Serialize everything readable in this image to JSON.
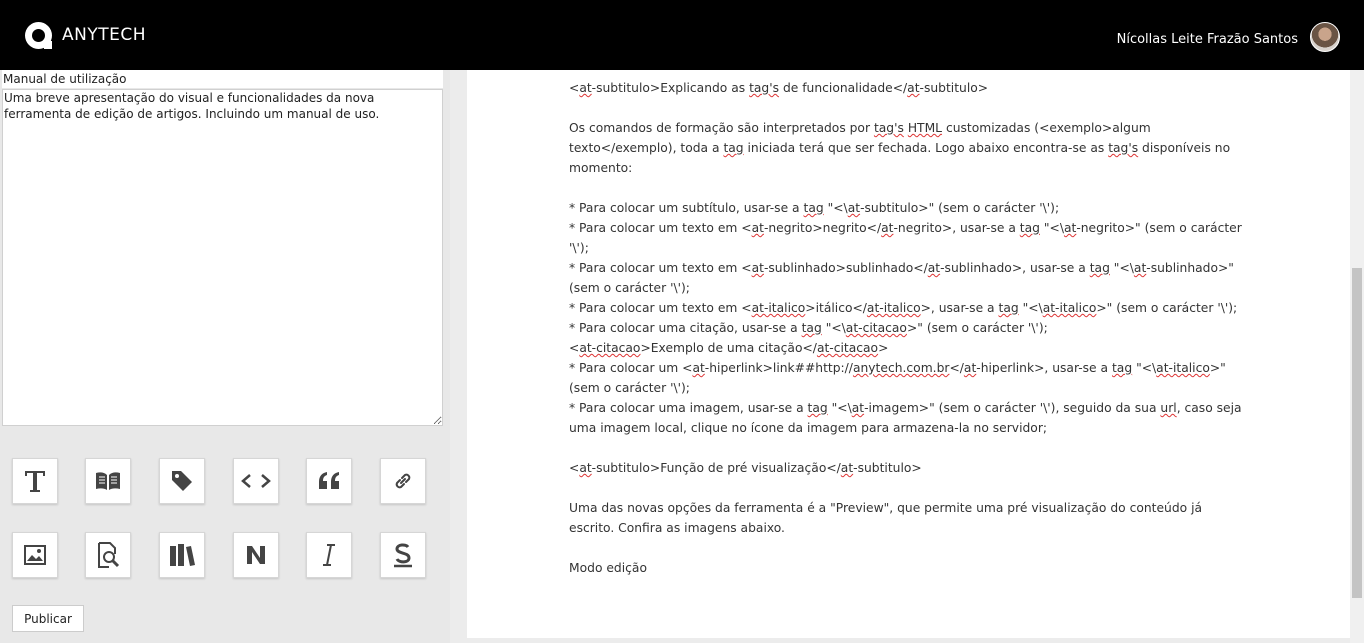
{
  "header": {
    "brand": "ANYTECH",
    "user_name": "Nícollas Leite Frazão Santos"
  },
  "editor": {
    "title_value": "Manual de utilização",
    "description_value": "Uma breve apresentação do visual e funcionalidades da nova ferramenta de edição de artigos. Incluindo um manual de uso.",
    "publish_label": "Publicar"
  },
  "toolbar": {
    "row1": [
      "subtitle",
      "reading",
      "tag",
      "code",
      "quote",
      "link"
    ],
    "row2": [
      "image",
      "preview",
      "library",
      "bold",
      "italic",
      "underline"
    ]
  },
  "article": {
    "l1": [
      "<",
      "at",
      "-subtitulo>Explicando as ",
      "tag's",
      " de funcionalidade</",
      "at",
      "-subtitulo>"
    ],
    "l2": [
      "Os comandos de formação são interpretados por ",
      "tag's",
      " ",
      "HTML",
      " customizadas (<exemplo>algum texto</exemplo), toda a ",
      "tag",
      " iniciada terá que ser fechada. Logo abaixo encontra-se as ",
      "tag's",
      " disponíveis no momento:"
    ],
    "l3": [
      "* Para colocar um subtítulo, usar-se a ",
      "tag",
      " \"<\\",
      "at",
      "-subtitulo>\" (sem o carácter '\\');"
    ],
    "l4": [
      "* Para colocar um texto em <",
      "at",
      "-negrito>negrito</",
      "at",
      "-negrito>, usar-se a ",
      "tag",
      " \"<\\",
      "at",
      "-negrito>\" (sem o carácter '\\');"
    ],
    "l5": [
      "* Para colocar um texto em <",
      "at",
      "-sublinhado>sublinhado</",
      "at",
      "-sublinhado>, usar-se a ",
      "tag",
      " \"<\\",
      "at",
      "-sublinhado>\" (sem o carácter '\\');"
    ],
    "l6": [
      "* Para colocar um texto em <",
      "at-italico",
      ">itálico</",
      "at-italico",
      ">, usar-se a ",
      "tag",
      " \"<\\",
      "at-italico",
      ">\" (sem o carácter '\\');"
    ],
    "l7": [
      "* Para colocar uma citação, usar-se a ",
      "tag",
      " \"<\\",
      "at-citacao",
      ">\" (sem o carácter '\\');"
    ],
    "l8": [
      "<",
      "at-citacao",
      ">Exemplo de uma citação</",
      "at-citacao",
      ">"
    ],
    "l9": [
      "* Para colocar um <",
      "at",
      "-hiperlink>link##http://",
      "anytech.com.br",
      "</",
      "at",
      "-hiperlink>, usar-se a ",
      "tag",
      " \"<\\",
      "at-italico",
      ">\" (sem o carácter '\\');"
    ],
    "l10": [
      "* Para colocar uma imagem, usar-se a ",
      "tag",
      " \"<\\",
      "at",
      "-imagem>\" (sem o carácter '\\'), seguido da sua ",
      "url",
      ", caso seja uma imagem local, clique no ícone da imagem para armazena-la no servidor;"
    ],
    "l11": [
      "<",
      "at",
      "-subtitulo>Função de pré visualização</",
      "at",
      "-subtitulo>"
    ],
    "l12": [
      "Uma das novas opções da ferramenta é a \"Preview\", que permite uma pré visualização do conteúdo já escrito. Confira as imagens abaixo."
    ],
    "l13": [
      "Modo edição"
    ]
  }
}
